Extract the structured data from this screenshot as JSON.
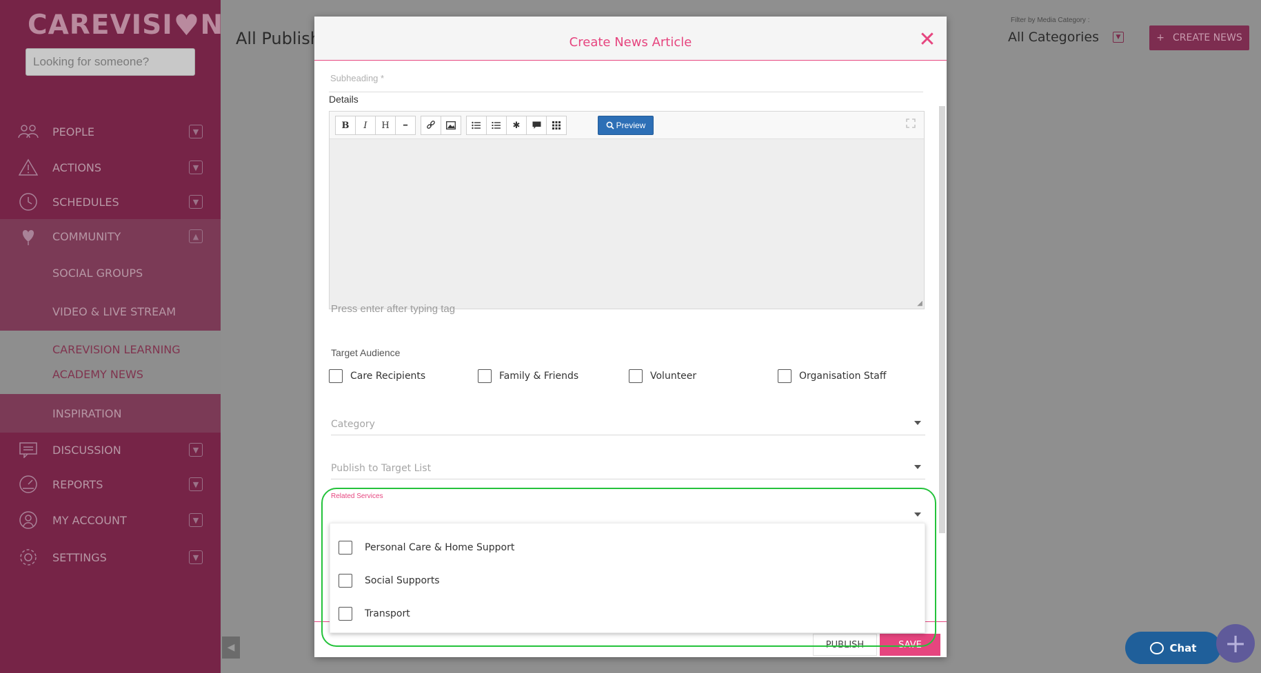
{
  "app": {
    "logo_text": "CAREVISI",
    "logo_heart": "♥",
    "logo_tail": "N",
    "search_placeholder": "Looking for someone?"
  },
  "sidebar": {
    "items": [
      {
        "label": "PEOPLE",
        "icon": "people-icon"
      },
      {
        "label": "ACTIONS",
        "icon": "warning-icon"
      },
      {
        "label": "SCHEDULES",
        "icon": "clock-icon"
      },
      {
        "label": "COMMUNITY",
        "icon": "balloon-heart-icon"
      },
      {
        "label": "DISCUSSION",
        "icon": "chat-box-icon"
      },
      {
        "label": "REPORTS",
        "icon": "gauge-icon"
      },
      {
        "label": "MY ACCOUNT",
        "icon": "user-icon"
      },
      {
        "label": "SETTINGS",
        "icon": "gear-icon"
      }
    ],
    "community_sub": [
      "SOCIAL GROUPS",
      "VIDEO & LIVE STREAM",
      "CAREVISION LEARNING",
      "ACADEMY NEWS",
      "INSPIRATION"
    ]
  },
  "header": {
    "page_title": "All Publish",
    "filter_label": "Filter by Media Category :",
    "filter_value": "All Categories",
    "create_button": "CREATE NEWS",
    "create_plus": "+"
  },
  "modal": {
    "title": "Create News Article",
    "subheading_label": "Subheading *",
    "details_label": "Details",
    "toolbar": {
      "bold": "B",
      "italic": "I",
      "heading": "H",
      "hr": "━",
      "link": "🔗",
      "image": "▣",
      "ul": "☰",
      "ol": "☷",
      "special": "✱",
      "comment": "▬",
      "table": "▦",
      "preview": "Preview",
      "fullscreen": "⤢"
    },
    "tag_placeholder": "Press enter after typing tag",
    "target_audience_label": "Target Audience",
    "audience": [
      "Care Recipients",
      "Family & Friends",
      "Volunteer",
      "Organisation Staff"
    ],
    "category_placeholder": "Category",
    "target_list_placeholder": "Publish to Target List",
    "related_services_label": "Related Services",
    "related_services_options": [
      "Personal Care & Home Support",
      "Social Supports",
      "Transport"
    ],
    "publish_button": "PUBLISH",
    "save_button": "SAVE",
    "close_symbol": "✕"
  },
  "chat": {
    "label": "Chat"
  },
  "fab": {
    "symbol": "+"
  },
  "colors": {
    "accent": "#e6457f",
    "sidebar": "#762447",
    "highlight": "#23c23a",
    "preview": "#2d6fb6"
  }
}
